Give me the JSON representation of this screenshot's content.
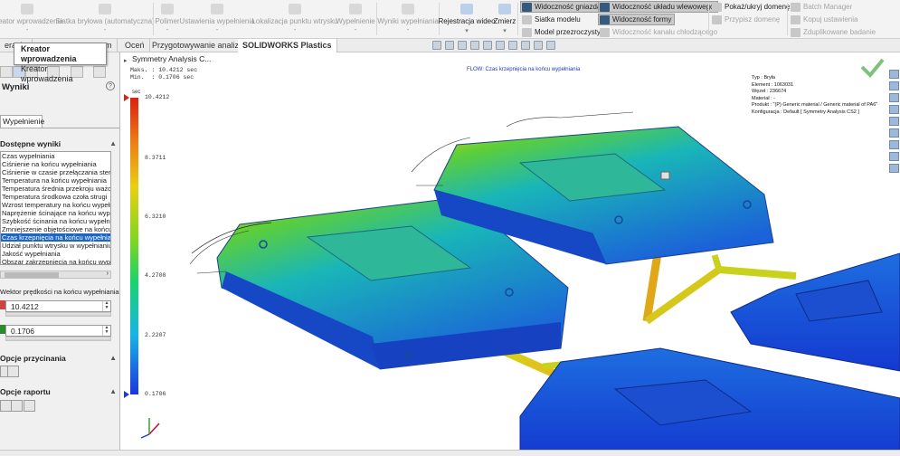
{
  "ribbon": {
    "large_buttons": [
      {
        "label": "Kreator wprowadzenia",
        "enabled": false
      },
      {
        "label": "Siatka bryłowa (automatyczna)",
        "enabled": false
      },
      {
        "label": "Polimer",
        "enabled": false
      },
      {
        "label": "Ustawienia wypełnienia",
        "enabled": false
      },
      {
        "label": "Lokalizacja punktu wtrysku",
        "enabled": false
      },
      {
        "label": "Wypełnienie",
        "enabled": false
      },
      {
        "label": "Wyniki wypełniania",
        "enabled": false
      },
      {
        "label": "Rejestracja wideo",
        "enabled": true
      },
      {
        "label": "Zmierz",
        "enabled": true
      }
    ],
    "group1": [
      {
        "label": "Widoczność gniazda",
        "state": "selected"
      },
      {
        "label": "Siatka modelu",
        "state": "normal"
      },
      {
        "label": "Model przezroczysty",
        "state": "normal"
      }
    ],
    "group2": [
      {
        "label": "Widoczność układu wlewowego",
        "state": "selected"
      },
      {
        "label": "Widoczność formy",
        "state": "selected"
      },
      {
        "label": "Widoczność kanału chłodzącego",
        "state": "disabled"
      }
    ],
    "group3": [
      {
        "label": "Pokaż/ukryj domenę",
        "state": "normal"
      },
      {
        "label": "Przypisz domenę",
        "state": "disabled"
      }
    ],
    "group4": [
      {
        "label": "Batch Manager",
        "state": "disabled"
      },
      {
        "label": "Kopuj ustawienia",
        "state": "disabled"
      },
      {
        "label": "Zduplikowane badanie",
        "state": "disabled"
      }
    ]
  },
  "tabs": [
    {
      "label": "eracje"
    },
    {
      "label": "rm"
    },
    {
      "label": "Oceń"
    },
    {
      "label": "Przygotowywanie analizy"
    },
    {
      "label": "SOLIDWORKS Plastics"
    }
  ],
  "tooltip": {
    "title": "Kreator wprowadzenia",
    "text": "Kreator wprowadzenia"
  },
  "panel": {
    "title": "Wyniki",
    "help": "?",
    "tab": "Wypełnienie",
    "section_results": "Dostępne wyniki",
    "results": [
      "Czas wypełniania",
      "Ciśnienie na końcu wypełniania",
      "Ciśnienie w czasie przełączania sterowania",
      "Temperatura na końcu wypełniania",
      "Temperatura średnia przekroju ważona wg",
      "Temperatura środkowa czoła strugi",
      "Wzrost temperatury na końcu wypełniania",
      "Naprężenie ścinające na końcu wypełniania",
      "Szybkość ścinania na końcu wypełniania",
      "Zmniejszenie objętościowe na końcu wypełn",
      "Czas krzepnięcia na końcu wypełniania",
      "Udział punktu wtrysku w wypełnianiu",
      "Jakość wypełniania",
      "Obszar zakrzepnięcia na końcu wypełniania"
    ],
    "selected_index": 10,
    "vector_label": "Wektor prędkości na końcu wypełniania",
    "max_value": "10.4212",
    "min_value": "0.1706",
    "section_clipping": "Opcje przycinania",
    "section_report": "Opcje raportu"
  },
  "viewport": {
    "scene_name": "Symmetry Analysis C...",
    "plot_title": "FLOW: Czas krzepnięcia na końcu wypełniania",
    "max_text": "Maks. : 10.4212 sec",
    "min_text": "Min.  : 0.1706 sec",
    "unit": "sec",
    "legend_ticks": [
      "10.4212",
      "8.3711",
      "6.3210",
      "4.2708",
      "2.2207",
      "0.1706"
    ],
    "info_lines": [
      "Typ : Bryła",
      "Element : 1063031",
      "Węzeł : 236674",
      "Materiał : -",
      "Produkt :   \"(P) Generic material / Generic material of PA6\"",
      "Konfiguracja : Default [ Symmetry Analysis CS2 ]"
    ]
  },
  "colors": {
    "highlight": "#1c66c8",
    "accent_red": "#dc1f14",
    "accent_blue": "#1a35e0"
  }
}
